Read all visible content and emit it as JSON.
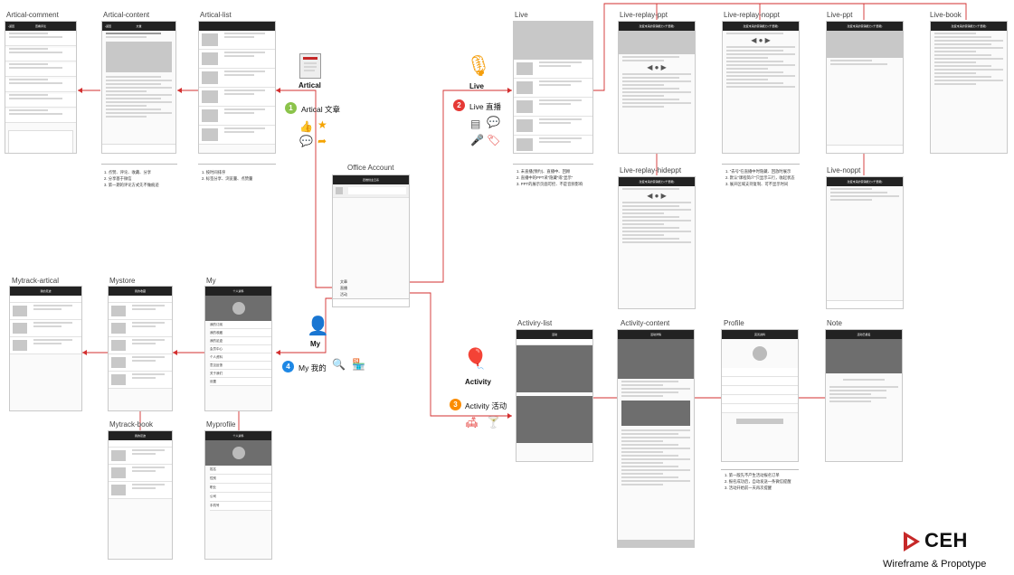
{
  "screens": {
    "artical_comment": "Artical-comment",
    "artical_content": "Artical-content",
    "artical_list": "Artical-list",
    "live": "Live",
    "live_replay_ppt": "Live-replay-ppt",
    "live_replay_noppt": "Live-replay-noppt",
    "live_ppt": "Live-ppt",
    "live_book": "Live-book",
    "live_replay_hideppt": "Live-replay-hideppt",
    "live_noppt": "Live-noppt",
    "office_account": "Office Account",
    "mytrack_artical": "Mytrack-artical",
    "mystore": "Mystore",
    "my": "My",
    "mytrack_book": "Mytrack-book",
    "myprofile": "Myprofile",
    "activity_list": "Activiry-list",
    "activity_content": "Activity-content",
    "profile": "Profile",
    "note": "Note"
  },
  "sections": {
    "artical": {
      "num": "1",
      "label": "Artical  文章",
      "title": "Artical",
      "color": "#8bc34a"
    },
    "live": {
      "num": "2",
      "label": "Live  直播",
      "title": "Live",
      "color": "#e53935"
    },
    "my": {
      "num": "4",
      "label": "My  我的",
      "title": "My",
      "color": "#1e88e5"
    },
    "activity": {
      "num": "3",
      "label": "Activity  活动",
      "title": "Activity",
      "color": "#fb8c00"
    }
  },
  "notes": {
    "artical_content": [
      "1. 点赞、评论、收藏、分享",
      "2. 分享基于微信",
      "3. 第一期的评论方式先不做痕迹"
    ],
    "artical_list": [
      "1. 按时间排序",
      "2. 标签分享、浏览量、点赞量"
    ],
    "live": [
      "1. 未直播(预约)、直播中、回顾",
      "2. 直播中的PPT采\"隐藏\"或\"显示\"",
      "3. PPT的展示页面可控、不是音频影响"
    ],
    "live_replay": [
      "1. \"去号\"在直播中时隐藏、回放时展示",
      "2. 默认\"课程简介\"只显示三行，收起状态",
      "3. 展开区域支持复制、可不显示时间"
    ],
    "activity": [
      "1. 第一版先不产生活动报名订单",
      "2. 报名成功后，自动发送一条微信提醒",
      "3. 活动开始前一天再次提醒"
    ]
  },
  "phone_titles": {
    "comment": "查看评论",
    "content": "文章",
    "office": "四维创业云系",
    "my": "个人资料",
    "mystore": "我的收藏",
    "mytrack": "我的足迹",
    "activity": "活动",
    "activity_content": "活动详情",
    "profile": "完善资料",
    "note": "活动已报名",
    "live_header": "改变未来的营销能力 (千里眼)"
  },
  "office_menu": [
    "文章",
    "直播",
    "活动"
  ],
  "my_menu": [
    "我的订阅",
    "我的收藏",
    "我的足迹",
    "会员中心",
    "个人资料",
    "意见反馈",
    "关于我们",
    "设置"
  ],
  "profile_fields": [
    "姓名",
    "性别",
    "职业",
    "公司",
    "手机号"
  ],
  "brand": {
    "logo": "CEH",
    "tagline": "Wireframe & Propotype",
    "accent": "#c62828"
  },
  "colors": {
    "link": "#d32f2f",
    "dark": "#222222",
    "placeholder": "#c8c8c8"
  }
}
